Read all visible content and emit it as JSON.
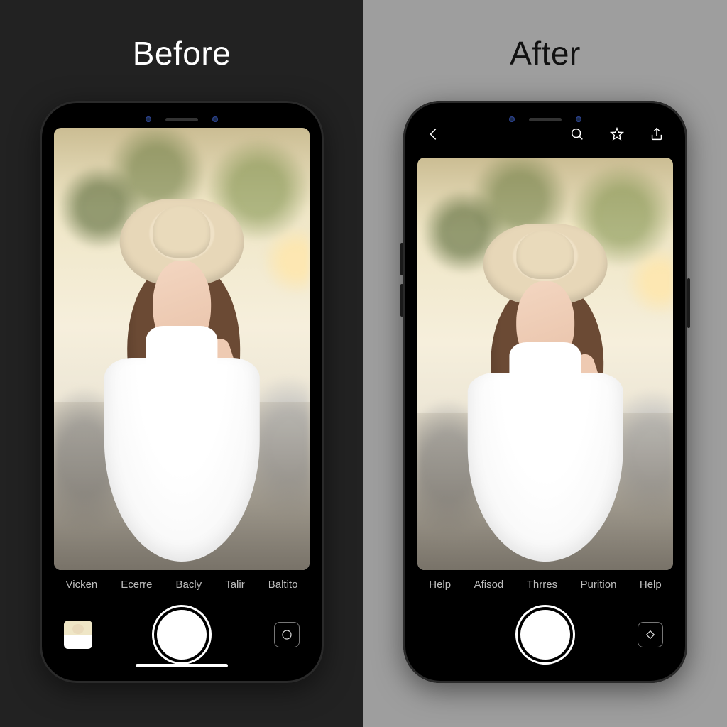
{
  "left": {
    "heading": "Before",
    "modes": [
      "Vicken",
      "Ecerre",
      "Bacly",
      "Talir",
      "Baltito"
    ]
  },
  "right": {
    "heading": "After",
    "toolbar_icons": {
      "back": "back-chevron-icon",
      "search": "search-icon",
      "star": "star-icon",
      "share": "share-icon"
    },
    "modes": [
      "Help",
      "Afisod",
      "Thrres",
      "Purition",
      "Help"
    ]
  },
  "photo_description": "Young woman in a white dress and straw sun hat, golden-hour backlight, parked cars and trees bokeh background"
}
